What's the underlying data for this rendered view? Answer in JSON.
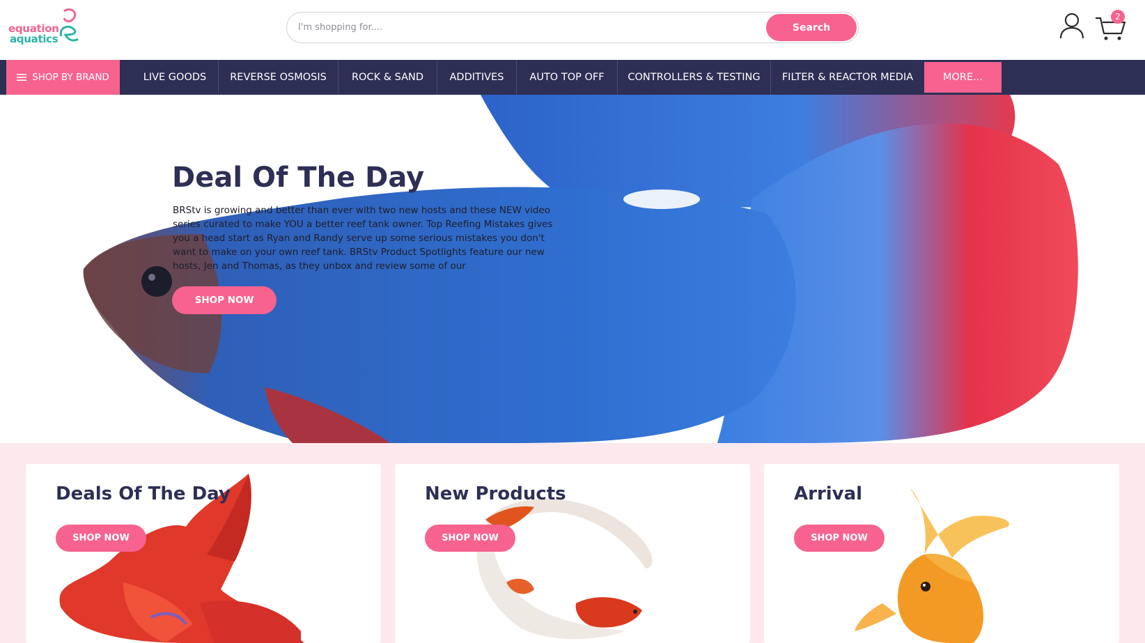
{
  "header": {
    "logo": {
      "line1": "equation",
      "line2": "aquatics"
    },
    "search": {
      "placeholder": "I'm shopping for....",
      "button_label": "Search"
    },
    "cart": {
      "count": "2"
    }
  },
  "nav": {
    "brand_button": "SHOP BY BRAND",
    "items": [
      "LIVE GOODS",
      "REVERSE OSMOSIS",
      "ROCK & SAND",
      "ADDITIVES",
      "AUTO TOP OFF",
      "CONTROLLERS & TESTING",
      "FILTER & REACTOR MEDIA"
    ],
    "more": "MORE..."
  },
  "hero": {
    "title": "Deal Of The Day",
    "text": "BRStv is growing and better than ever with two new hosts and these NEW video series curated to make YOU a better reef tank owner. Top Reefing Mistakes gives you a head start as Ryan and Randy serve up some serious mistakes you don't want to make on your own reef tank. BRStv Product Spotlights feature our new hosts, Jen and Thomas, as they unbox and review some of our",
    "button": "SHOP NOW"
  },
  "cards": [
    {
      "title": "Deals Of The Day",
      "button": "SHOP NOW"
    },
    {
      "title": "New Products",
      "button": "SHOP NOW"
    },
    {
      "title": "Arrival",
      "button": "SHOP NOW"
    }
  ],
  "colors": {
    "accent": "#f7628f",
    "navy": "#2d2f55",
    "teal": "#2bb3a6",
    "section_bg": "#fde8ee"
  },
  "icons": [
    "hamburger-icon",
    "user-icon",
    "cart-icon"
  ]
}
